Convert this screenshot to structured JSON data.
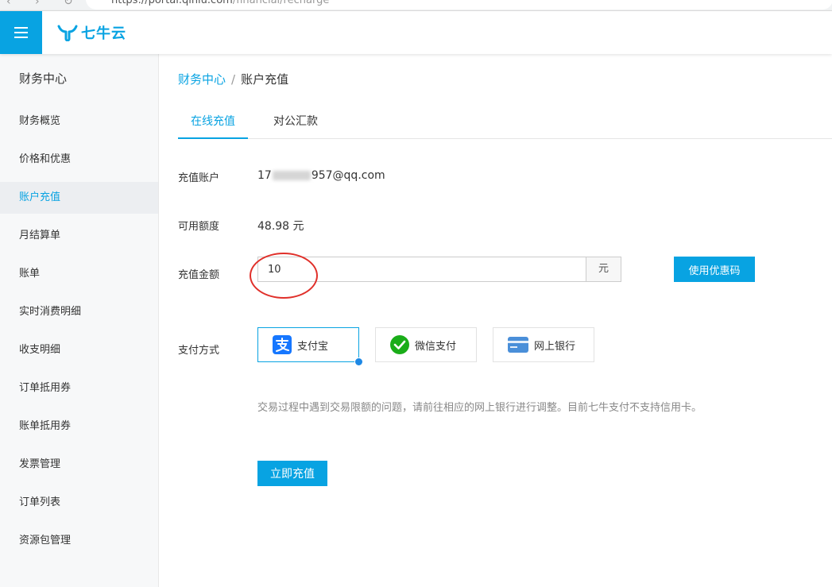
{
  "browser": {
    "url_host": "https://portal.qiniu.com",
    "url_path": "/financial/recharge"
  },
  "header": {
    "logo_text": "七牛云",
    "brand_color": "#08a3e2"
  },
  "sidebar": {
    "title": "财务中心",
    "items": [
      {
        "label": "财务概览"
      },
      {
        "label": "价格和优惠"
      },
      {
        "label": "账户充值",
        "active": true
      },
      {
        "label": "月结算单"
      },
      {
        "label": "账单"
      },
      {
        "label": "实时消费明细"
      },
      {
        "label": "收支明细"
      },
      {
        "label": "订单抵用券"
      },
      {
        "label": "账单抵用券"
      },
      {
        "label": "发票管理"
      },
      {
        "label": "订单列表"
      },
      {
        "label": "资源包管理"
      }
    ]
  },
  "breadcrumb": {
    "parent": "财务中心",
    "separator": "/",
    "current": "账户充值"
  },
  "tabs": [
    {
      "label": "在线充值",
      "active": true
    },
    {
      "label": "对公汇款"
    }
  ],
  "form": {
    "account_label": "充值账户",
    "account_prefix": "17",
    "account_suffix": "957@qq.com",
    "balance_label": "可用额度",
    "balance_value": "48.98 元",
    "amount_label": "充值金额",
    "amount_value": "10",
    "amount_unit": "元",
    "coupon_button": "使用优惠码",
    "payment_label": "支付方式",
    "payment_options": [
      {
        "label": "支付宝",
        "icon": "alipay-icon",
        "selected": true
      },
      {
        "label": "微信支付",
        "icon": "wechat-pay-icon"
      },
      {
        "label": "网上银行",
        "icon": "bank-card-icon"
      }
    ],
    "notice": "交易过程中遇到交易限额的问题，请前往相应的网上银行进行调整。目前七牛支付不支持信用卡。",
    "submit_button": "立即充值"
  }
}
